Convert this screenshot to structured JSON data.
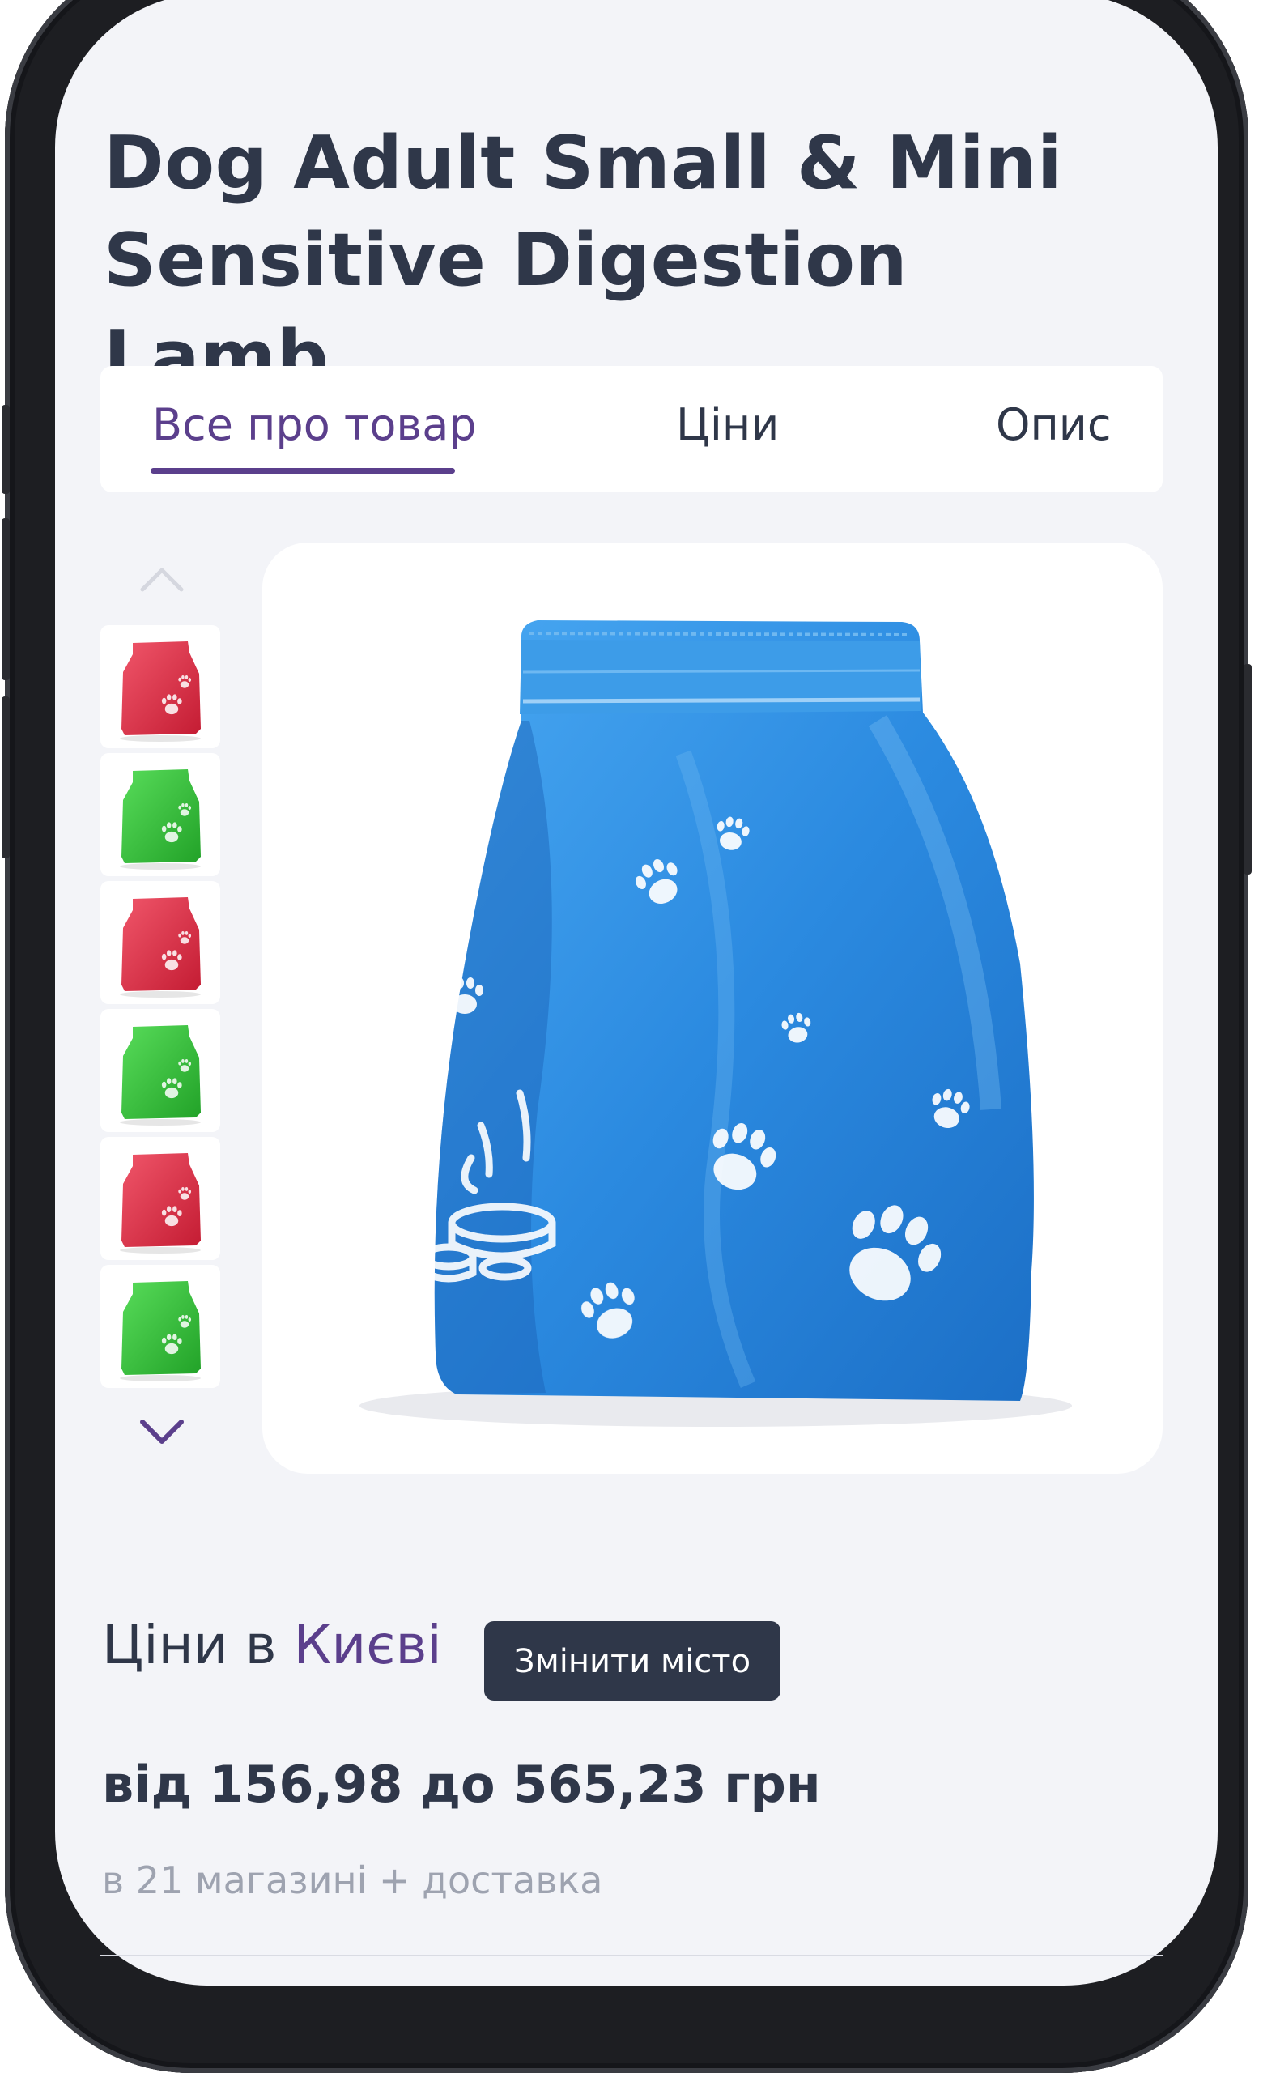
{
  "product": {
    "title": "Dog Adult Small & Mini Sensitive Digestion Lamb"
  },
  "tabs": [
    {
      "label": "Все про товар",
      "active": true
    },
    {
      "label": "Ціни",
      "active": false
    },
    {
      "label": "Опис",
      "active": false
    }
  ],
  "gallery": {
    "thumbnails": [
      {
        "color": "#e23247",
        "icon": "red-food-bag"
      },
      {
        "color": "#33c23a",
        "icon": "green-food-bag"
      },
      {
        "color": "#e23247",
        "icon": "red-food-bag"
      },
      {
        "color": "#33c23a",
        "icon": "green-food-bag"
      },
      {
        "color": "#e23247",
        "icon": "red-food-bag"
      },
      {
        "color": "#33c23a",
        "icon": "green-food-bag"
      }
    ],
    "scroll_up_icon": "chevron-up-icon",
    "scroll_down_icon": "chevron-down-icon",
    "main_image": {
      "color": "#2f8fe0",
      "icon": "blue-food-bag-with-paw-prints"
    }
  },
  "prices": {
    "heading_prefix": "Ціни в",
    "city": "Києві",
    "change_city_label": "Змінити місто",
    "range": "від 156,98 до 565,23 грн",
    "stores_note": "в 21 магазині + доставка"
  },
  "colors": {
    "accent": "#5b3f8c",
    "text": "#2f3749",
    "muted": "#9ea3b0",
    "background": "#f3f4f8"
  }
}
